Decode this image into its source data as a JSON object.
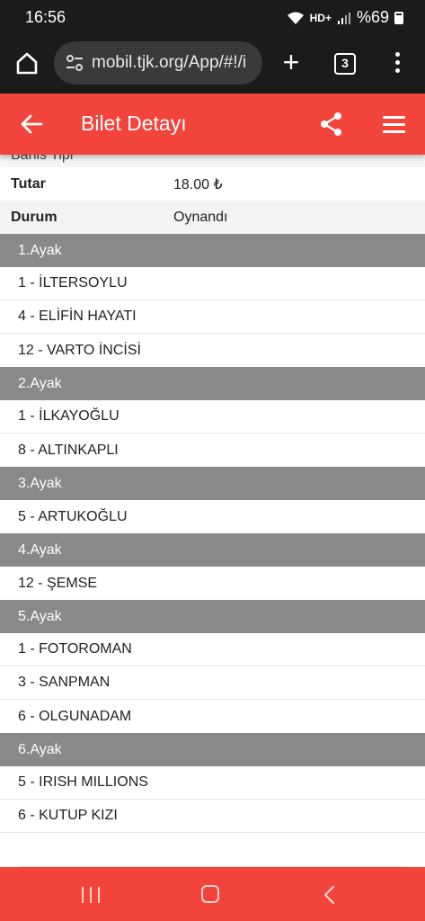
{
  "status_bar": {
    "time": "16:56",
    "battery_text": "%69",
    "network_text": "HD+"
  },
  "browser": {
    "url": "mobil.tjk.org/App/#!/i",
    "tab_count": "3"
  },
  "header": {
    "title": "Bilet Detayı",
    "accent_color": "#f2443a"
  },
  "details": {
    "cut_label": "Bahis Tipi",
    "rows": [
      {
        "label": "Tutar",
        "value": "18.00 ₺"
      },
      {
        "label": "Durum",
        "value": "Oynandı"
      }
    ]
  },
  "legs": [
    {
      "title": "1.Ayak",
      "horses": [
        "1 - İLTERSOYLU",
        "4 - ELİFİN HAYATI",
        "12 - VARTO İNCİSİ"
      ]
    },
    {
      "title": "2.Ayak",
      "horses": [
        "1 - İLKAYOĞLU",
        "8 - ALTINKAPLI"
      ]
    },
    {
      "title": "3.Ayak",
      "horses": [
        "5 - ARTUKOĞLU"
      ]
    },
    {
      "title": "4.Ayak",
      "horses": [
        "12 - ŞEMSE"
      ]
    },
    {
      "title": "5.Ayak",
      "horses": [
        "1 - FOTOROMAN",
        "3 - SANPMAN",
        "6 - OLGUNADAM"
      ]
    },
    {
      "title": "6.Ayak",
      "horses": [
        "5 - IRISH MILLIONS",
        "6 - KUTUP KIZI"
      ]
    }
  ],
  "icons": {
    "home": "home-icon",
    "tune": "tune-icon",
    "plus": "plus-icon",
    "tabs": "tabs-icon",
    "more": "more-vert-icon",
    "back": "arrow-back-icon",
    "share": "share-icon",
    "menu": "hamburger-icon"
  }
}
